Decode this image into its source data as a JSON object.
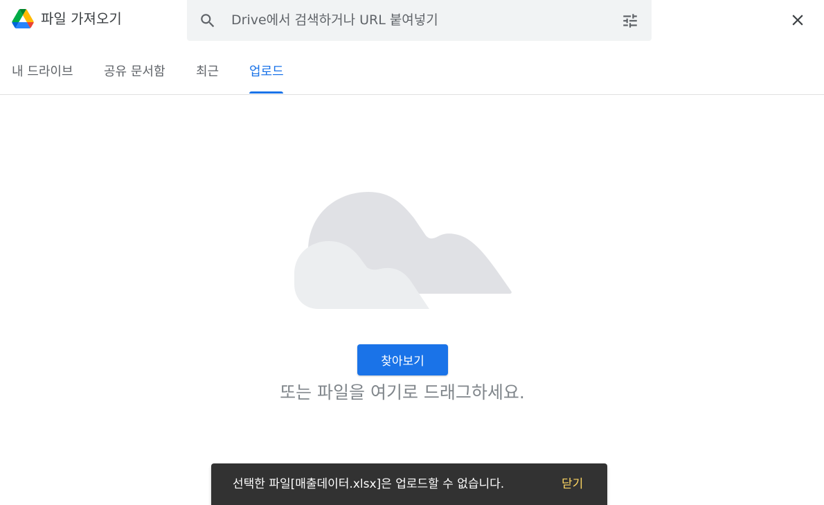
{
  "header": {
    "title": "파일 가져오기",
    "search_placeholder": "Drive에서 검색하거나 URL 붙여넣기",
    "search_value": ""
  },
  "tabs": [
    {
      "label": "내 드라이브",
      "active": false
    },
    {
      "label": "공유 문서함",
      "active": false
    },
    {
      "label": "최근",
      "active": false
    },
    {
      "label": "업로드",
      "active": true
    }
  ],
  "upload": {
    "browse_label": "찾아보기",
    "drag_text": "또는 파일을 여기로 드래그하세요."
  },
  "snackbar": {
    "message": "선택한 파일[매출데이터.xlsx]은 업로드할 수 없습니다.",
    "action": "닫기"
  },
  "icons": {
    "logo": "google-drive-logo",
    "search": "search-icon",
    "filter": "tune-icon",
    "close": "close-icon",
    "illustration": "cloud-illustration"
  },
  "colors": {
    "accent": "#1a73e8",
    "snackbar_bg": "#323232",
    "snackbar_action": "#fdd663",
    "search_bg": "#f1f3f4"
  }
}
